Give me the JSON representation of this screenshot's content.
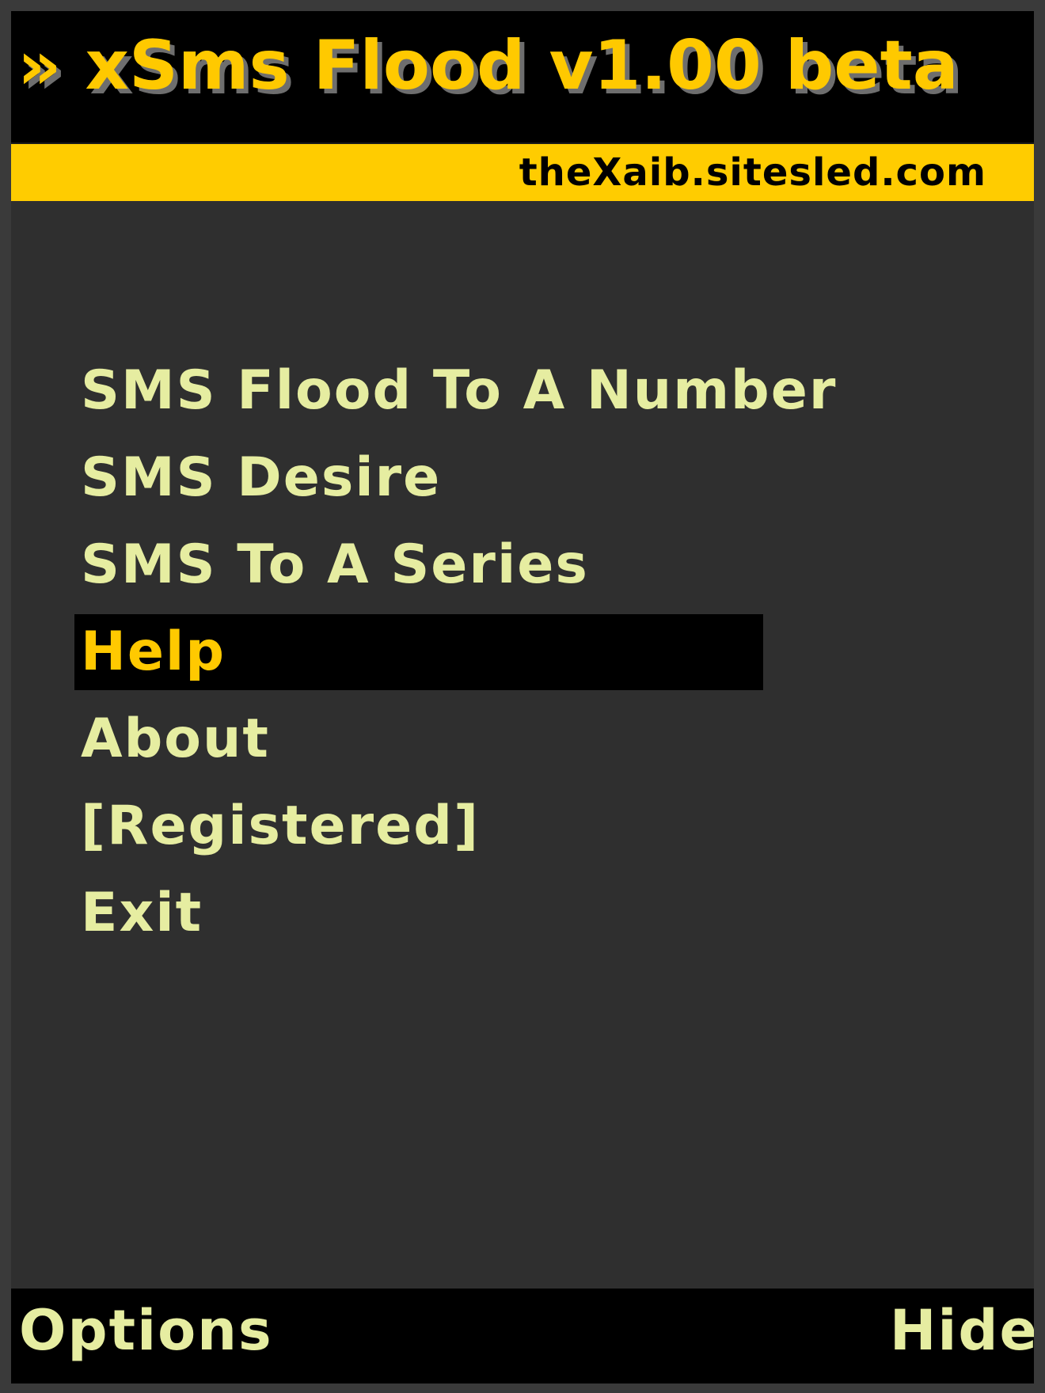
{
  "app": {
    "title": "» xSms Flood v1.00 beta",
    "url": "theXaib.sitesled.com"
  },
  "menu": {
    "items": [
      {
        "label": "SMS Flood To A Number",
        "selected": false
      },
      {
        "label": "SMS Desire",
        "selected": false
      },
      {
        "label": "SMS To A Series",
        "selected": false
      },
      {
        "label": "Help",
        "selected": true
      },
      {
        "label": "About",
        "selected": false
      },
      {
        "label": "[Registered]",
        "selected": false
      },
      {
        "label": "Exit",
        "selected": false
      }
    ]
  },
  "softkeys": {
    "left": "Options",
    "right": "Hide"
  },
  "colors": {
    "background": "#2f2f2f",
    "titlebar": "#000000",
    "accent": "#ffcc00",
    "menu_text": "#e6eda1",
    "selected_text": "#ffc900",
    "selected_background": "#000000"
  }
}
